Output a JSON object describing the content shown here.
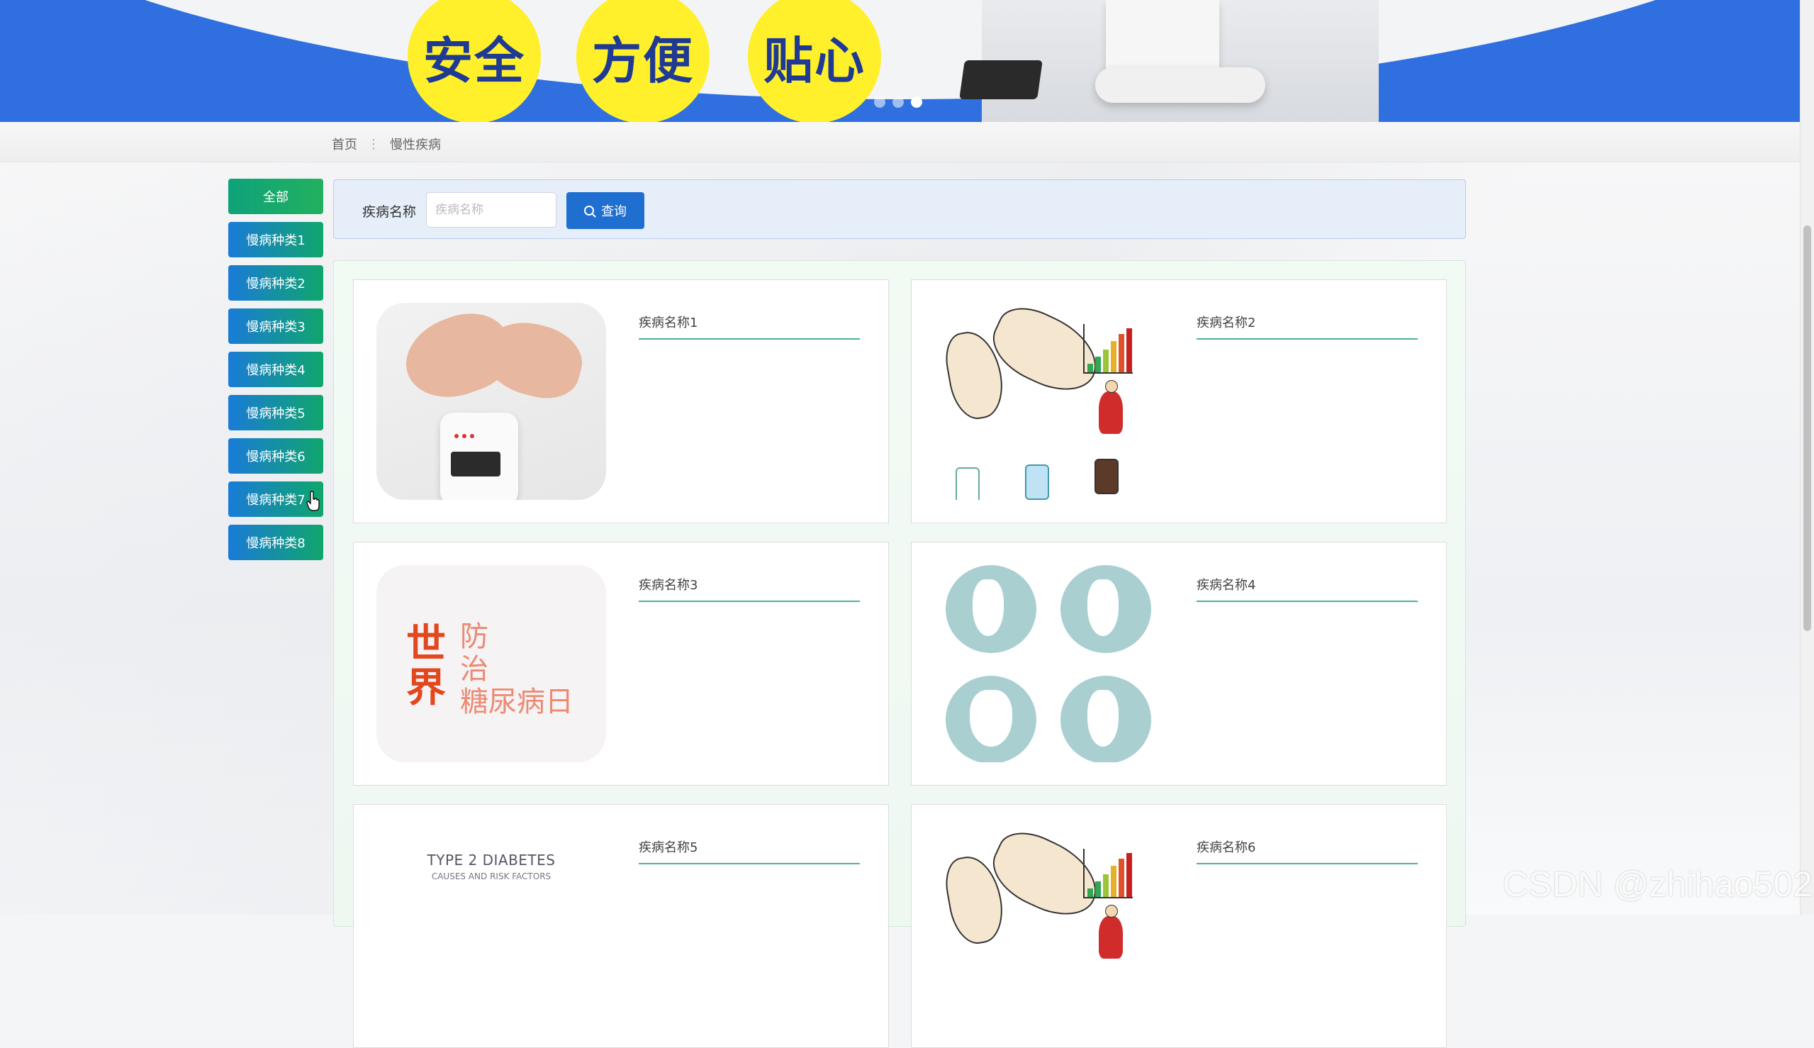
{
  "banner": {
    "circles": [
      "安全",
      "方便",
      "贴心"
    ],
    "slide_count": 3,
    "active_slide": 3
  },
  "breadcrumb": {
    "home": "首页",
    "separator": "⋮",
    "current": "慢性疾病"
  },
  "sidebar": {
    "items": [
      {
        "label": "全部",
        "active": true
      },
      {
        "label": "慢病种类1"
      },
      {
        "label": "慢病种类2"
      },
      {
        "label": "慢病种类3"
      },
      {
        "label": "慢病种类4"
      },
      {
        "label": "慢病种类5"
      },
      {
        "label": "慢病种类6"
      },
      {
        "label": "慢病种类7"
      },
      {
        "label": "慢病种类8"
      }
    ]
  },
  "search": {
    "label": "疾病名称",
    "placeholder": "疾病名称",
    "value": "",
    "button_label": "查询",
    "button_icon": "search-icon"
  },
  "cards": [
    {
      "name": "疾病名称1"
    },
    {
      "name": "疾病名称2"
    },
    {
      "name": "疾病名称3",
      "thumb_big": "世界",
      "thumb_text": "防\n治\n糖尿病日"
    },
    {
      "name": "疾病名称4"
    },
    {
      "name": "疾病名称5",
      "thumb_title": "TYPE 2 DIABETES",
      "thumb_subtitle": "CAUSES AND RISK FACTORS"
    },
    {
      "name": "疾病名称6"
    }
  ],
  "watermark": "CSDN @zhihao502",
  "colors": {
    "banner_blue": "#2f6fe0",
    "circle_yellow": "#fff02b",
    "primary_button": "#1f6fd1",
    "side_gradient_start": "#1a7bd8",
    "side_gradient_end": "#10a66c",
    "card_underline": "#4db38a"
  }
}
